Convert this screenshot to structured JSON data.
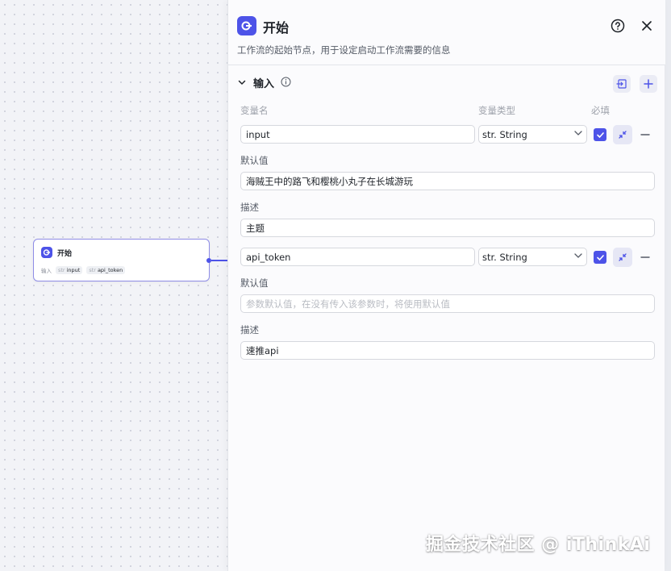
{
  "node": {
    "title": "开始",
    "row_label": "输入",
    "chips": [
      {
        "type": "str",
        "name": "input"
      },
      {
        "type": "str",
        "name": "api_token"
      }
    ]
  },
  "panel": {
    "title": "开始",
    "description": "工作流的起始节点，用于设定启动工作流需要的信息",
    "section_title": "输入",
    "columns": {
      "name": "变量名",
      "type": "变量类型",
      "required": "必填"
    },
    "default_label": "默认值",
    "desc_label": "描述",
    "default_placeholder": "参数默认值，在没有传入该参数时，将使用默认值",
    "variables": [
      {
        "name": "input",
        "type": "str. String",
        "required": true,
        "default": "海贼王中的路飞和樱桃小丸子在长城游玩",
        "description": "主题"
      },
      {
        "name": "api_token",
        "type": "str. String",
        "required": true,
        "default": "",
        "description": "速推api"
      }
    ]
  },
  "watermark": "掘金技术社区 @ iThinkAi",
  "colors": {
    "accent": "#4d53e8",
    "node_border": "#8f8de6"
  }
}
